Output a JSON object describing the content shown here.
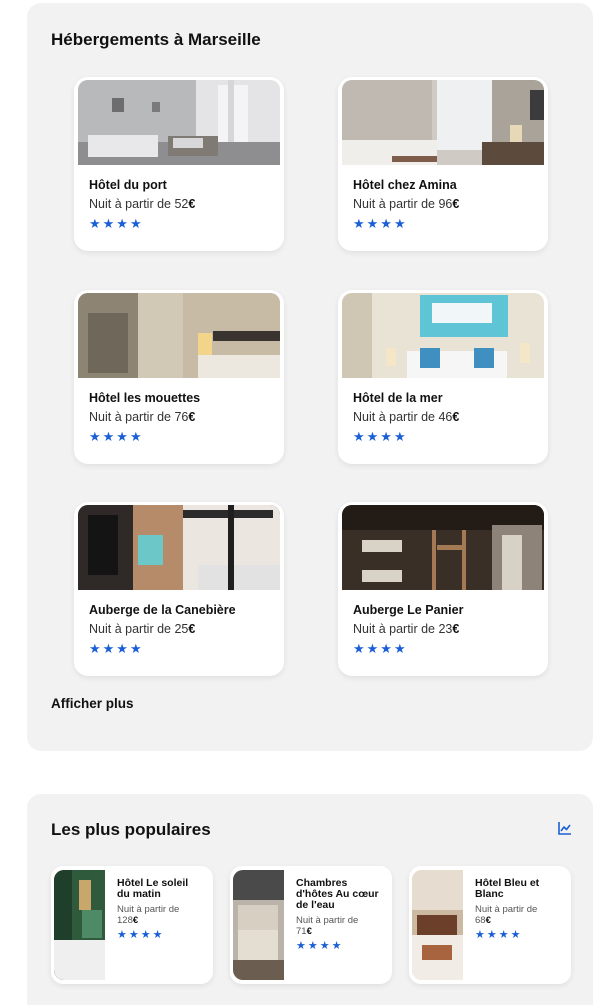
{
  "hebergements": {
    "title": "Hébergements à Marseille",
    "price_prefix": "Nuit à partir de ",
    "currency": "€",
    "star_color": "#1a5fd6",
    "cards": [
      {
        "name": "Hôtel du port",
        "price": "52",
        "stars": 4,
        "rating_display": "★★★★",
        "image": "bedroom-white-window-photo"
      },
      {
        "name": "Hôtel chez Amina",
        "price": "96",
        "stars": 4,
        "rating_display": "★★★★",
        "image": "bedroom-desk-tv-photo"
      },
      {
        "name": "Hôtel les mouettes",
        "price": "76",
        "stars": 4,
        "rating_display": "★★★★",
        "image": "bedroom-ornate-wallpaper-photo"
      },
      {
        "name": "Hôtel de la mer",
        "price": "46",
        "stars": 4,
        "rating_display": "★★★★",
        "image": "bedroom-sea-painting-photo"
      },
      {
        "name": "Auberge de la Canebière",
        "price": "25",
        "stars": 4,
        "rating_display": "★★★★",
        "image": "dorm-bunk-beds-photo"
      },
      {
        "name": "Auberge Le Panier",
        "price": "23",
        "stars": 4,
        "rating_display": "★★★★",
        "image": "dorm-wooden-bunks-photo"
      }
    ],
    "show_more": "Afficher plus"
  },
  "populaires": {
    "title": "Les plus populaires",
    "trend_icon": "trending-chart-icon",
    "items": [
      {
        "name_lines": [
          "Hôtel Le soleil",
          "du matin"
        ],
        "price_lines": [
          "Nuit à partir de",
          "128"
        ],
        "stars": 4,
        "rating_display": "★★★★",
        "image": "green-room-photo"
      },
      {
        "name_lines": [
          "Chambres",
          "d'hôtes Au cœur",
          "de l'eau"
        ],
        "price_lines": [
          "Nuit à partir de",
          "71"
        ],
        "stars": 4,
        "rating_display": "★★★★",
        "image": "guest-room-photo"
      },
      {
        "name_lines": [
          "Hôtel Bleu et",
          "Blanc"
        ],
        "price_lines": [
          "Nuit à partir de",
          "68"
        ],
        "stars": 4,
        "rating_display": "★★★★",
        "image": "classic-room-photo"
      }
    ]
  }
}
